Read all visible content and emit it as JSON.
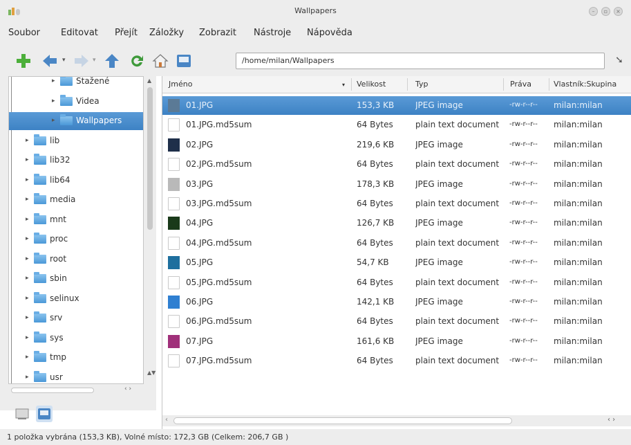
{
  "window": {
    "title": "Wallpapers"
  },
  "menu": [
    "Soubor",
    "Editovat",
    "Přejít",
    "Záložky",
    "Zobrazit",
    "Nástroje",
    "Nápověda"
  ],
  "toolbar": {
    "location": "/home/milan/Wallpapers",
    "icons": [
      "add-icon",
      "back-icon",
      "forward-icon",
      "up-icon",
      "reload-icon",
      "home-icon",
      "computer-icon",
      "go-icon"
    ],
    "accent": "#3d82c4"
  },
  "tree": {
    "items": [
      {
        "label": "Stažené",
        "indent": 2
      },
      {
        "label": "Videa",
        "indent": 2
      },
      {
        "label": "Wallpapers",
        "indent": 2,
        "selected": true
      },
      {
        "label": "lib",
        "indent": 1
      },
      {
        "label": "lib32",
        "indent": 1
      },
      {
        "label": "lib64",
        "indent": 1
      },
      {
        "label": "media",
        "indent": 1
      },
      {
        "label": "mnt",
        "indent": 1
      },
      {
        "label": "proc",
        "indent": 1
      },
      {
        "label": "root",
        "indent": 1
      },
      {
        "label": "sbin",
        "indent": 1
      },
      {
        "label": "selinux",
        "indent": 1
      },
      {
        "label": "srv",
        "indent": 1
      },
      {
        "label": "sys",
        "indent": 1
      },
      {
        "label": "tmp",
        "indent": 1
      },
      {
        "label": "usr",
        "indent": 1
      }
    ]
  },
  "columns": [
    "Jméno",
    "Velikost",
    "Typ",
    "Práva",
    "Vlastník:Skupina"
  ],
  "files": [
    {
      "name": "01.JPG",
      "size": "153,3 KB",
      "type": "JPEG image",
      "perms": "-rw-r--r--",
      "owner": "milan:milan",
      "icon": "image",
      "selected": true,
      "thumb": "#5b7a96"
    },
    {
      "name": "01.JPG.md5sum",
      "size": "64 Bytes",
      "type": "plain text document",
      "perms": "-rw-r--r--",
      "owner": "milan:milan",
      "icon": "text"
    },
    {
      "name": "02.JPG",
      "size": "219,6 KB",
      "type": "JPEG image",
      "perms": "-rw-r--r--",
      "owner": "milan:milan",
      "icon": "image",
      "thumb": "#1f2f4a"
    },
    {
      "name": "02.JPG.md5sum",
      "size": "64 Bytes",
      "type": "plain text document",
      "perms": "-rw-r--r--",
      "owner": "milan:milan",
      "icon": "text"
    },
    {
      "name": "03.JPG",
      "size": "178,3 KB",
      "type": "JPEG image",
      "perms": "-rw-r--r--",
      "owner": "milan:milan",
      "icon": "image",
      "thumb": "#b9b9b9"
    },
    {
      "name": "03.JPG.md5sum",
      "size": "64 Bytes",
      "type": "plain text document",
      "perms": "-rw-r--r--",
      "owner": "milan:milan",
      "icon": "text"
    },
    {
      "name": "04.JPG",
      "size": "126,7 KB",
      "type": "JPEG image",
      "perms": "-rw-r--r--",
      "owner": "milan:milan",
      "icon": "image",
      "thumb": "#1a3a1a"
    },
    {
      "name": "04.JPG.md5sum",
      "size": "64 Bytes",
      "type": "plain text document",
      "perms": "-rw-r--r--",
      "owner": "milan:milan",
      "icon": "text"
    },
    {
      "name": "05.JPG",
      "size": "54,7 KB",
      "type": "JPEG image",
      "perms": "-rw-r--r--",
      "owner": "milan:milan",
      "icon": "image",
      "thumb": "#1e6f9e"
    },
    {
      "name": "05.JPG.md5sum",
      "size": "64 Bytes",
      "type": "plain text document",
      "perms": "-rw-r--r--",
      "owner": "milan:milan",
      "icon": "text"
    },
    {
      "name": "06.JPG",
      "size": "142,1 KB",
      "type": "JPEG image",
      "perms": "-rw-r--r--",
      "owner": "milan:milan",
      "icon": "image",
      "thumb": "#2f7fd1"
    },
    {
      "name": "06.JPG.md5sum",
      "size": "64 Bytes",
      "type": "plain text document",
      "perms": "-rw-r--r--",
      "owner": "milan:milan",
      "icon": "text"
    },
    {
      "name": "07.JPG",
      "size": "161,6 KB",
      "type": "JPEG image",
      "perms": "-rw-r--r--",
      "owner": "milan:milan",
      "icon": "image",
      "thumb": "#a0307a"
    },
    {
      "name": "07.JPG.md5sum",
      "size": "64 Bytes",
      "type": "plain text document",
      "perms": "-rw-r--r--",
      "owner": "milan:milan",
      "icon": "text"
    }
  ],
  "status": {
    "text": "1 položka vybrána (153,3 KB), Volné místo: 172,3 GB (Celkem: 206,7 GB )"
  }
}
